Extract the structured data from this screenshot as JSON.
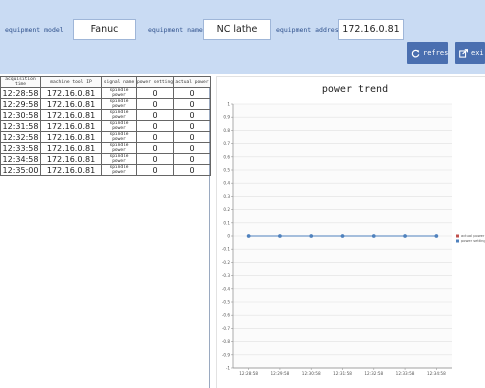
{
  "header": {
    "equipment_model_label": "equipment model",
    "equipment_model_value": "Fanuc",
    "equipment_name_label": "equipment name",
    "equipment_name_value": "NC lathe",
    "equipment_address_label": "equipment address",
    "equipment_address_value": "172.16.0.81",
    "refresh_label": "refresh",
    "exit_label": "exi"
  },
  "table": {
    "columns": [
      "acquisition time",
      "machine tool IP",
      "signal name",
      "power setting",
      "actual power"
    ],
    "rows": [
      [
        "12:28:58",
        "172.16.0.81",
        "spindle power",
        "0",
        "0"
      ],
      [
        "12:29:58",
        "172.16.0.81",
        "spindle power",
        "0",
        "0"
      ],
      [
        "12:30:58",
        "172.16.0.81",
        "spindle power",
        "0",
        "0"
      ],
      [
        "12:31:58",
        "172.16.0.81",
        "spindle power",
        "0",
        "0"
      ],
      [
        "12:32:58",
        "172.16.0.81",
        "spindle power",
        "0",
        "0"
      ],
      [
        "12:33:58",
        "172.16.0.81",
        "spindle power",
        "0",
        "0"
      ],
      [
        "12:34:58",
        "172.16.0.81",
        "spindle power",
        "0",
        "0"
      ],
      [
        "12:35:00",
        "172.16.0.81",
        "spindle power",
        "0",
        "0"
      ]
    ]
  },
  "chart_data": {
    "type": "line",
    "title": "power trend",
    "categories": [
      "12:28:58",
      "12:29:58",
      "12:30:58",
      "12:31:58",
      "12:32:58",
      "12:33:58",
      "12:34:58"
    ],
    "series": [
      {
        "name": "actual power",
        "values": [
          0,
          0,
          0,
          0,
          0,
          0,
          0
        ],
        "color": "#c0504d"
      },
      {
        "name": "power setting",
        "values": [
          0,
          0,
          0,
          0,
          0,
          0,
          0
        ],
        "color": "#4f81bd"
      }
    ],
    "ylim": [
      -1,
      1
    ],
    "yticks": [
      "1",
      "0.9",
      "0.8",
      "0.7",
      "0.6",
      "0.5",
      "0.4",
      "0.3",
      "0.2",
      "0.1",
      "0",
      "-0.1",
      "-0.2",
      "-0.3",
      "-0.4",
      "-0.5",
      "-0.6",
      "-0.7",
      "-0.8",
      "-0.9",
      "-1"
    ],
    "legend": "right",
    "grid": true
  },
  "colors": {
    "header_bg": "#c9dbf3",
    "button_bg": "#4a6fb0",
    "label_text": "#2d4f8b"
  }
}
